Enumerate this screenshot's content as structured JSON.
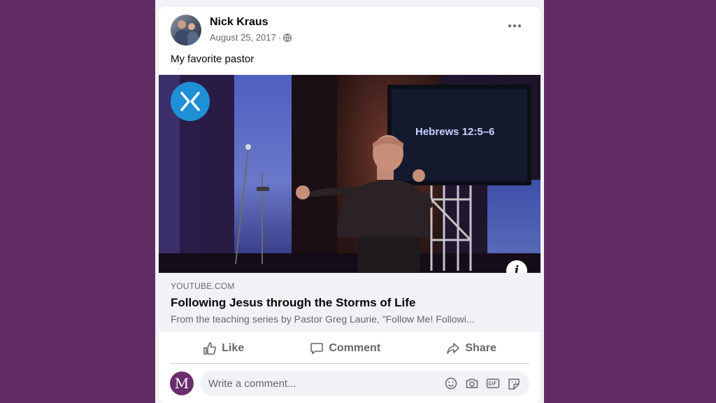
{
  "post": {
    "author": "Nick Kraus",
    "date": "August 25, 2017",
    "separator": "·",
    "privacy_icon": "globe-icon",
    "caption": "My favorite pastor"
  },
  "media": {
    "channel_logo": "x-logo",
    "screen_text": "Hebrews 12:5–6",
    "info_icon": "info-icon",
    "info_label": "i"
  },
  "link": {
    "domain": "YOUTUBE.COM",
    "title": "Following Jesus through the Storms of Life",
    "description": "From the teaching series by Pastor Greg Laurie, \"Follow Me! Followi..."
  },
  "actions": {
    "like": "Like",
    "comment": "Comment",
    "share": "Share"
  },
  "comment_box": {
    "avatar_letter": "M",
    "placeholder": "Write a comment...",
    "icons": [
      "emoji-icon",
      "camera-icon",
      "gif-icon",
      "sticker-icon"
    ]
  },
  "colors": {
    "background": "#612c63",
    "card": "#ffffff",
    "logo_blue": "#1f8fd6",
    "muted_text": "#65676b"
  }
}
